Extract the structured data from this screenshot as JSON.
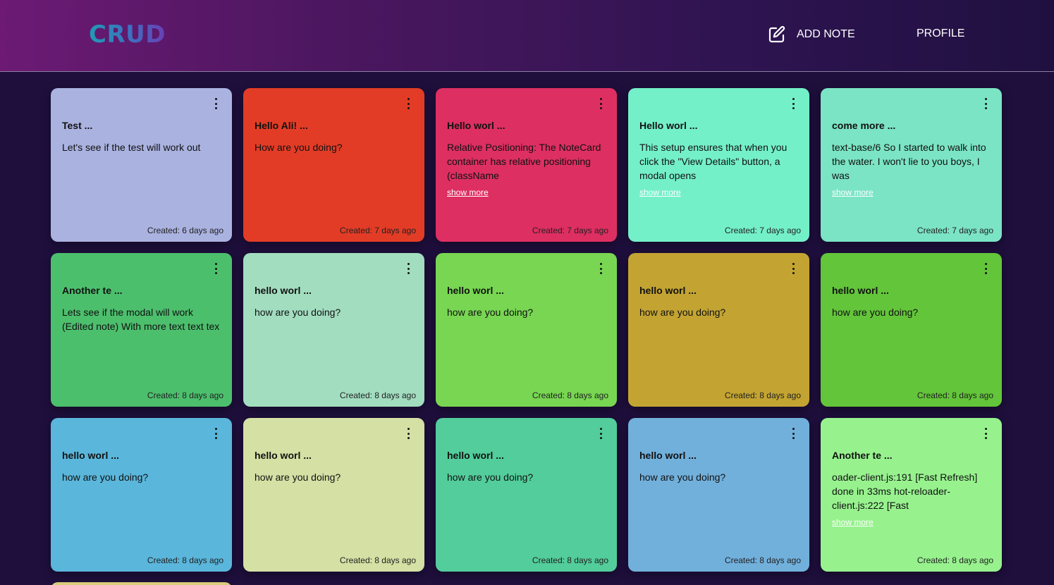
{
  "header": {
    "logo": "CRUD",
    "add_note_label": "ADD NOTE",
    "profile_label": "PROFILE"
  },
  "notes": [
    {
      "title": "Test ...",
      "body": "Let's see if the test will work out",
      "show_more": "",
      "created": "Created: 6 days ago",
      "color": "#aab2e0"
    },
    {
      "title": "Hello Ali! ...",
      "body": "How are you doing?",
      "show_more": "",
      "created": "Created: 7 days ago",
      "color": "#e33c26"
    },
    {
      "title": "Hello worl ...",
      "body": "Relative Positioning: The NoteCard container has relative positioning (className",
      "show_more": "show more",
      "created": "Created: 7 days ago",
      "color": "#de2f62"
    },
    {
      "title": "Hello worl ...",
      "body": "This setup ensures that when you click the \"View Details\" button, a modal opens",
      "show_more": "show more",
      "created": "Created: 7 days ago",
      "color": "#74f0c8"
    },
    {
      "title": "come more ...",
      "body": "text-base/6 So I started to walk into the water. I won't lie to you boys, I was",
      "show_more": "show more",
      "created": "Created: 7 days ago",
      "color": "#7be4c4"
    },
    {
      "title": "Another te ...",
      "body": "Lets see if the modal will work (Edited note) With more text text tex",
      "show_more": "",
      "created": "Created: 8 days ago",
      "color": "#4cbf6d"
    },
    {
      "title": "hello worl ...",
      "body": "how are you doing?",
      "show_more": "",
      "created": "Created: 8 days ago",
      "color": "#a2ddbf"
    },
    {
      "title": "hello worl ...",
      "body": "how are you doing?",
      "show_more": "",
      "created": "Created: 8 days ago",
      "color": "#78d652"
    },
    {
      "title": "hello worl ...",
      "body": "how are you doing?",
      "show_more": "",
      "created": "Created: 8 days ago",
      "color": "#c3a432"
    },
    {
      "title": "hello worl ...",
      "body": "how are you doing?",
      "show_more": "",
      "created": "Created: 8 days ago",
      "color": "#63c53a"
    },
    {
      "title": "hello worl ...",
      "body": "how are you doing?",
      "show_more": "",
      "created": "Created: 8 days ago",
      "color": "#5ab6db"
    },
    {
      "title": "hello worl ...",
      "body": "how are you doing?",
      "show_more": "",
      "created": "Created: 8 days ago",
      "color": "#d4e0a4"
    },
    {
      "title": "hello worl ...",
      "body": "how are you doing?",
      "show_more": "",
      "created": "Created: 8 days ago",
      "color": "#52cd9b"
    },
    {
      "title": "hello worl ...",
      "body": "how are you doing?",
      "show_more": "",
      "created": "Created: 8 days ago",
      "color": "#72b0dc"
    },
    {
      "title": "Another te ...",
      "body": "oader-client.js:191 [Fast Refresh] done in 33ms hot-reloader-client.js:222 [Fast",
      "show_more": "show more",
      "created": "Created: 8 days ago",
      "color": "#97f28e"
    }
  ],
  "icons": {
    "add_note": "edit-icon",
    "card_menu": "kebab-menu-icon"
  }
}
